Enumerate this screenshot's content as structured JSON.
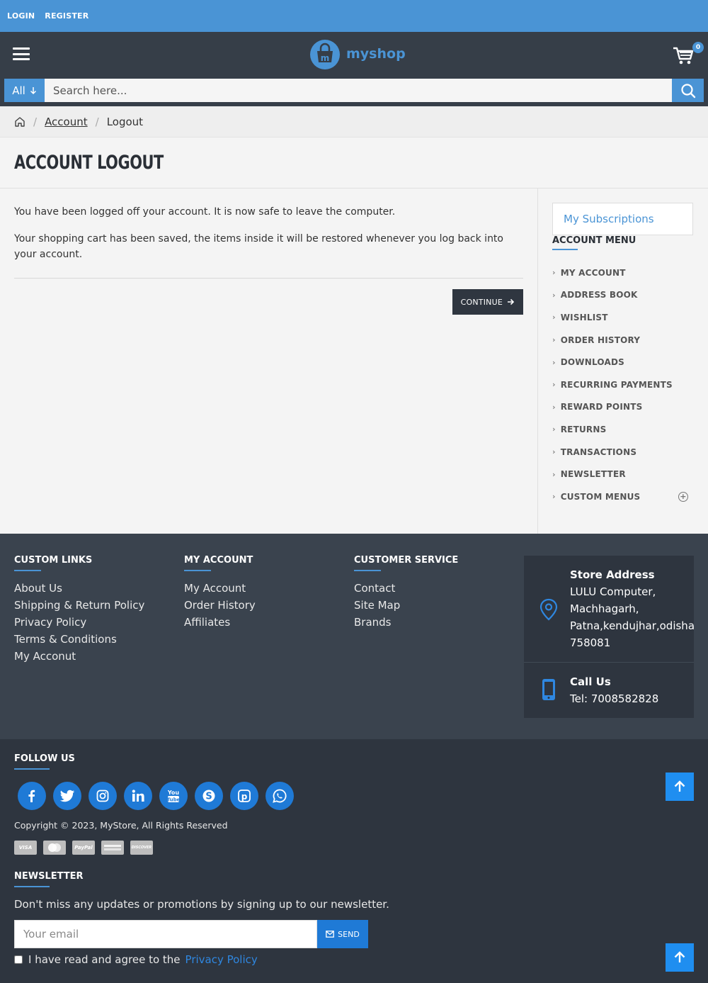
{
  "topbar": {
    "login": "LOGIN",
    "register": "REGISTER"
  },
  "header": {
    "logo_text": "myshop",
    "cart_count": "0"
  },
  "search": {
    "category": "All",
    "placeholder": "Search here..."
  },
  "breadcrumb": {
    "account": "Account",
    "current": "Logout"
  },
  "page": {
    "title": "ACCOUNT LOGOUT",
    "para1": "You have been logged off your account. It is now safe to leave the computer.",
    "para2": "Your shopping cart has been saved, the items inside it will be restored whenever you log back into your account.",
    "continue": "CONTINUE"
  },
  "sidebar": {
    "subscriptions": "My Subscriptions",
    "menu_title": "ACCOUNT MENU",
    "items": [
      {
        "label": "MY ACCOUNT"
      },
      {
        "label": "ADDRESS BOOK"
      },
      {
        "label": "WISHLIST"
      },
      {
        "label": "ORDER HISTORY"
      },
      {
        "label": "DOWNLOADS"
      },
      {
        "label": "RECURRING PAYMENTS"
      },
      {
        "label": "REWARD POINTS"
      },
      {
        "label": "RETURNS"
      },
      {
        "label": "TRANSACTIONS"
      },
      {
        "label": "NEWSLETTER"
      },
      {
        "label": "CUSTOM MENUS"
      }
    ]
  },
  "footer": {
    "custom_links": {
      "title": "CUSTOM LINKS",
      "items": [
        "About Us",
        "Shipping & Return Policy",
        "Privacy Policy",
        "Terms & Conditions",
        "My Acconut"
      ]
    },
    "my_account": {
      "title": "MY ACCOUNT",
      "items": [
        "My Account",
        "Order History",
        "Affiliates"
      ]
    },
    "customer_service": {
      "title": "CUSTOMER SERVICE",
      "items": [
        "Contact",
        "Site Map",
        "Brands"
      ]
    },
    "store": {
      "address_title": "Store Address",
      "address_lines": [
        "LULU Computer,",
        "Machhagarh,",
        "Patna,kendujhar,odisha",
        "758081"
      ],
      "call_title": "Call Us",
      "phone": "Tel: 7008582828"
    },
    "follow_title": "FOLLOW US",
    "socials": [
      "facebook-icon",
      "twitter-icon",
      "instagram-icon",
      "linkedin-icon",
      "youtube-icon",
      "skype-icon",
      "pinterest-icon",
      "whatsapp-icon"
    ],
    "copyright": "Copyright © 2023, MyStore, All Rights Reserved",
    "payments": [
      "VISA",
      "",
      "PayPal",
      "",
      "DISCOVER"
    ],
    "newsletter_title": "NEWSLETTER",
    "newsletter_text": "Don't miss any updates or promotions by signing up to our newsletter.",
    "email_placeholder": "Your email",
    "send": "SEND",
    "agree_text": "I have read and agree to the",
    "privacy_link": "Privacy Policy"
  },
  "colors": {
    "accent": "#4a94d5",
    "header_bg": "#363e48",
    "footer_bg": "#3a434e",
    "footer_dark": "#2e353f",
    "social_blue": "#1f7ad6"
  }
}
